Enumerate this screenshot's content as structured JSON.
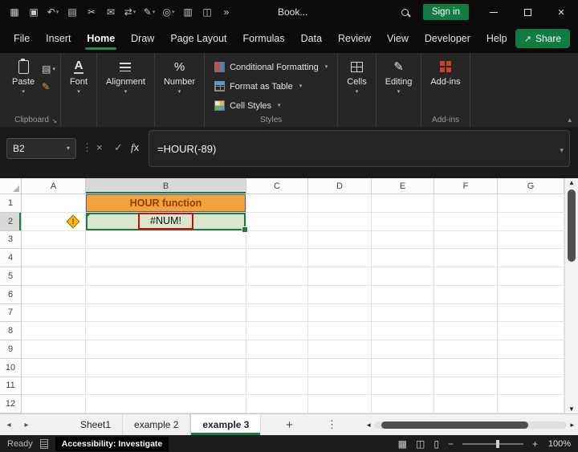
{
  "titlebar": {
    "doc_title": "Book...",
    "sign_in_label": "Sign in",
    "quick_icons": [
      {
        "name": "app-launcher-icon",
        "glyph": "▦"
      },
      {
        "name": "save-icon",
        "glyph": "▣"
      },
      {
        "name": "undo-icon",
        "glyph": "↶",
        "caret": true
      },
      {
        "name": "copy-page-icon",
        "glyph": "▤"
      },
      {
        "name": "cut-icon",
        "glyph": "✂"
      },
      {
        "name": "mail-icon",
        "glyph": "✉"
      },
      {
        "name": "translate-icon",
        "glyph": "⇄",
        "caret": true
      },
      {
        "name": "ink-pen-icon",
        "glyph": "✎",
        "caret": true
      },
      {
        "name": "shape-icon",
        "glyph": "◎",
        "caret": true
      },
      {
        "name": "table-icon",
        "glyph": "▥"
      },
      {
        "name": "camera-icon",
        "glyph": "◫"
      },
      {
        "name": "more-commands-icon",
        "glyph": "»"
      }
    ]
  },
  "menu": {
    "items": [
      "File",
      "Insert",
      "Home",
      "Draw",
      "Page Layout",
      "Formulas",
      "Data",
      "Review",
      "View",
      "Developer",
      "Help"
    ],
    "active_item": "Home",
    "share_label": "Share"
  },
  "ribbon": {
    "paste_label": "Paste",
    "clipboard_group_label": "Clipboard",
    "font_label": "Font",
    "alignment_label": "Alignment",
    "number_label": "Number",
    "styles_items": [
      "Conditional Formatting",
      "Format as Table",
      "Cell Styles"
    ],
    "styles_group_label": "Styles",
    "cells_label": "Cells",
    "editing_label": "Editing",
    "addins_label": "Add-ins",
    "addins_group_label": "Add-ins"
  },
  "formula_bar": {
    "name_box_value": "B2",
    "formula": "=HOUR(-89)"
  },
  "grid": {
    "column_headers": [
      "A",
      "B",
      "C",
      "D",
      "E",
      "F",
      "G"
    ],
    "row_headers": [
      "1",
      "2",
      "3",
      "4",
      "5",
      "6",
      "7",
      "8",
      "9",
      "10",
      "11",
      "12"
    ],
    "cells": [
      {
        "ref": "B1",
        "text": "HOUR function",
        "style": "orange-title"
      },
      {
        "ref": "B2",
        "text": "#NUM!",
        "style": "error-green"
      }
    ],
    "selected_cell": "B2",
    "selected_column": "B",
    "selected_row": "2",
    "warning_cell": "A2"
  },
  "sheet_tabs": {
    "tabs": [
      "Sheet1",
      "example 2",
      "example 3"
    ],
    "active_tab": "example 3",
    "add_tab_label": "+"
  },
  "status_bar": {
    "mode": "Ready",
    "accessibility_text": "Accessibility: Investigate",
    "zoom_label": "100%"
  },
  "colors": {
    "accent_green": "#107c41",
    "cell_title_fill": "#f0a23c",
    "cell_title_text": "#963a06",
    "cell_error_fill": "#d8e7cb",
    "annotation_red": "#cf0a0a",
    "addins_icon_red": "#cc4125"
  }
}
